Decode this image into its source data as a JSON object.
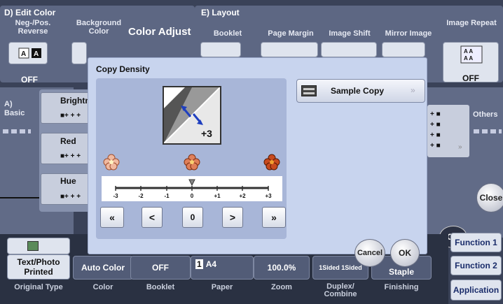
{
  "header": {
    "color_section": "D) Edit Color",
    "layout_section": "E) Layout",
    "neg_pos": "Neg-/Pos. Reverse",
    "background_color": "Background Color",
    "color_adjust": "Color Adjust",
    "booklet": "Booklet",
    "page_margin": "Page Margin",
    "image_shift": "Image Shift",
    "mirror_image": "Mirror Image",
    "image_repeat": "Image Repeat",
    "neg_pos_value": "OFF",
    "image_repeat_value": "OFF"
  },
  "left": {
    "basic_label": "A) Basic",
    "items": [
      {
        "label": "Brightness"
      },
      {
        "label": "Red"
      },
      {
        "label": "Hue"
      }
    ]
  },
  "right": {
    "others_label": "Others",
    "close_label": "Close",
    "ok_label": "OK"
  },
  "dialog": {
    "title": "Copy Density",
    "sample_copy": "Sample Copy",
    "light_label": "-3",
    "dark_label": "+3",
    "scale_ticks": [
      "-3",
      "-2",
      "-1",
      "0",
      "+1",
      "+2",
      "+3"
    ],
    "current_value": "0",
    "btn_far_left": "«",
    "btn_left": "<",
    "btn_center": "0",
    "btn_right": ">",
    "btn_far_right": "»",
    "cancel_label": "Cancel",
    "ok_label": "OK"
  },
  "bottom": {
    "tiles": [
      {
        "value": "Text/Photo Printed",
        "caption": "Original Type"
      },
      {
        "value": "Auto Color",
        "caption": "Color"
      },
      {
        "value": "OFF",
        "caption": "Booklet"
      },
      {
        "value": "A4",
        "caption": "Paper"
      },
      {
        "value": "100.0%",
        "caption": "Zoom"
      },
      {
        "value": "1Sided 1Sided",
        "caption": "Duplex/ Combine"
      },
      {
        "value": "Staple",
        "caption": "Finishing"
      }
    ],
    "paper_tray": "1",
    "function1": "Function 1",
    "function2": "Function 2",
    "application": "Application"
  }
}
